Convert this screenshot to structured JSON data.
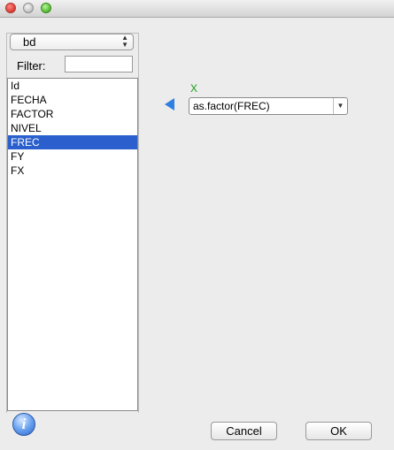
{
  "dataset": {
    "selected": "bd"
  },
  "filter": {
    "label": "Filter:",
    "value": ""
  },
  "variables": [
    "Id",
    "FECHA",
    "FACTOR",
    "NIVEL",
    "FREC",
    "FY",
    "FX"
  ],
  "selected_variable_index": 4,
  "x_field": {
    "label": "X",
    "value": "as.factor(FREC)"
  },
  "buttons": {
    "cancel": "Cancel",
    "ok": "OK"
  },
  "icons": {
    "info": "i"
  },
  "colors": {
    "selection": "#2a5fcd",
    "x_label": "#1a9a1a",
    "arrow": "#2f80e0"
  }
}
